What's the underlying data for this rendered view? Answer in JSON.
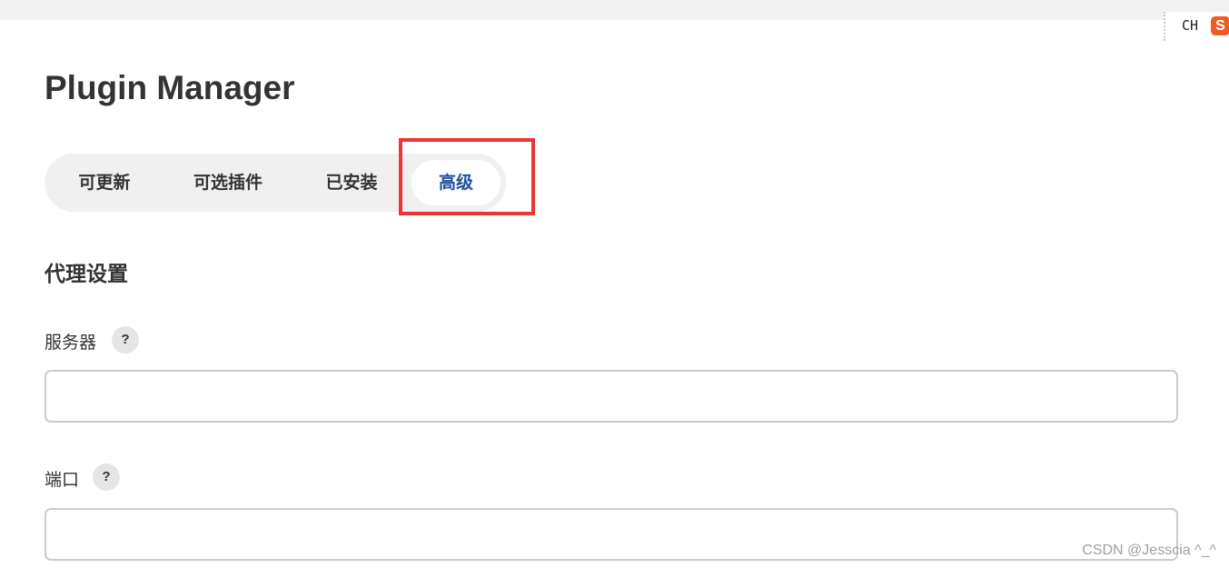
{
  "ime": {
    "label": "CH",
    "logo_glyph": "S",
    "logo_color": "#f15a22"
  },
  "page": {
    "title": "Plugin Manager"
  },
  "tabs": [
    {
      "label": "可更新",
      "active": false
    },
    {
      "label": "可选插件",
      "active": false
    },
    {
      "label": "已安装",
      "active": false
    },
    {
      "label": "高级",
      "active": true
    }
  ],
  "colors": {
    "active_tab_text": "#1f4fa0",
    "highlight_border": "#e8363a",
    "input_border": "#c6ccd2"
  },
  "proxy": {
    "section_title": "代理设置",
    "server": {
      "label": "服务器",
      "help": "?",
      "value": "",
      "placeholder": ""
    },
    "port": {
      "label": "端口",
      "help": "?",
      "value": "",
      "placeholder": ""
    }
  },
  "watermark": "CSDN @Jesscia ^_^"
}
